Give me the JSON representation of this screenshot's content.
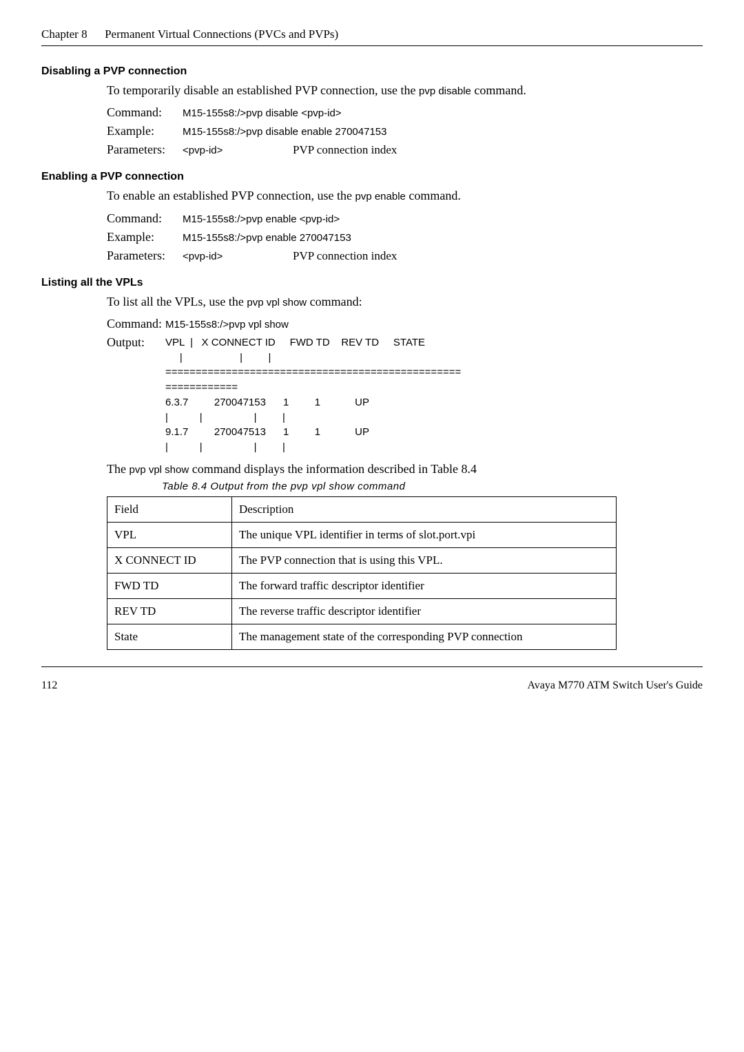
{
  "header": {
    "chapter": "Chapter 8",
    "title": "Permanent Virtual Connections (PVCs and PVPs)"
  },
  "sections": {
    "disable": {
      "heading": "Disabling a PVP connection",
      "intro_a": "To temporarily disable an established PVP connection, use the ",
      "intro_cmd": "pvp disable",
      "intro_b": " command.",
      "command_label": "Command:",
      "command_val": "M15-155s8:/>pvp disable <pvp-id>",
      "example_label": "Example:",
      "example_val": "M15-155s8:/>pvp disable enable 270047153",
      "param_label": "Parameters:",
      "param_name": "<pvp-id>",
      "param_desc": "PVP connection index"
    },
    "enable": {
      "heading": "Enabling a PVP connection",
      "intro_a": "To enable an established PVP connection, use the ",
      "intro_cmd": "pvp enable",
      "intro_b": " command.",
      "command_label": "Command:",
      "command_val": "M15-155s8:/>pvp enable <pvp-id>",
      "example_label": "Example:",
      "example_val": "M15-155s8:/>pvp enable 270047153",
      "param_label": "Parameters:",
      "param_name": "<pvp-id>",
      "param_desc": "PVP connection index"
    },
    "vpls": {
      "heading": "Listing all the VPLs",
      "intro_a": "To list all the VPLs, use the ",
      "intro_cmd": "pvp vpl show",
      "intro_b": " command:",
      "command_label": "Command:",
      "command_val": "M15-155s8:/>pvp vpl show",
      "output_label": "Output:",
      "output_lines": "VPL  |   X CONNECT ID     FWD TD    REV TD     STATE\n     |                    |         |\n=================================================\n============\n6.3.7         270047153      1         1            UP\n|           |                  |         |\n9.1.7         270047513      1         1            UP\n|           |                  |         |",
      "after_a": "The ",
      "after_cmd": "pvp vpl show",
      "after_b": " command displays the information described in Table 8.4"
    }
  },
  "table": {
    "caption": "Table 8.4  Output from the pvp vpl show command",
    "head_field": "Field",
    "head_desc": "Description",
    "rows": [
      {
        "field": "VPL",
        "desc": "The unique VPL identifier in terms of slot.port.vpi"
      },
      {
        "field": "X CONNECT ID",
        "desc": "The PVP connection that is using this VPL."
      },
      {
        "field": "FWD TD",
        "desc": "The forward traffic descriptor identifier"
      },
      {
        "field": "REV TD",
        "desc": "The reverse traffic descriptor identifier"
      },
      {
        "field": "State",
        "desc": "The management state of the corresponding PVP connection"
      }
    ]
  },
  "footer": {
    "page": "112",
    "doc": "Avaya M770 ATM Switch User's Guide"
  }
}
